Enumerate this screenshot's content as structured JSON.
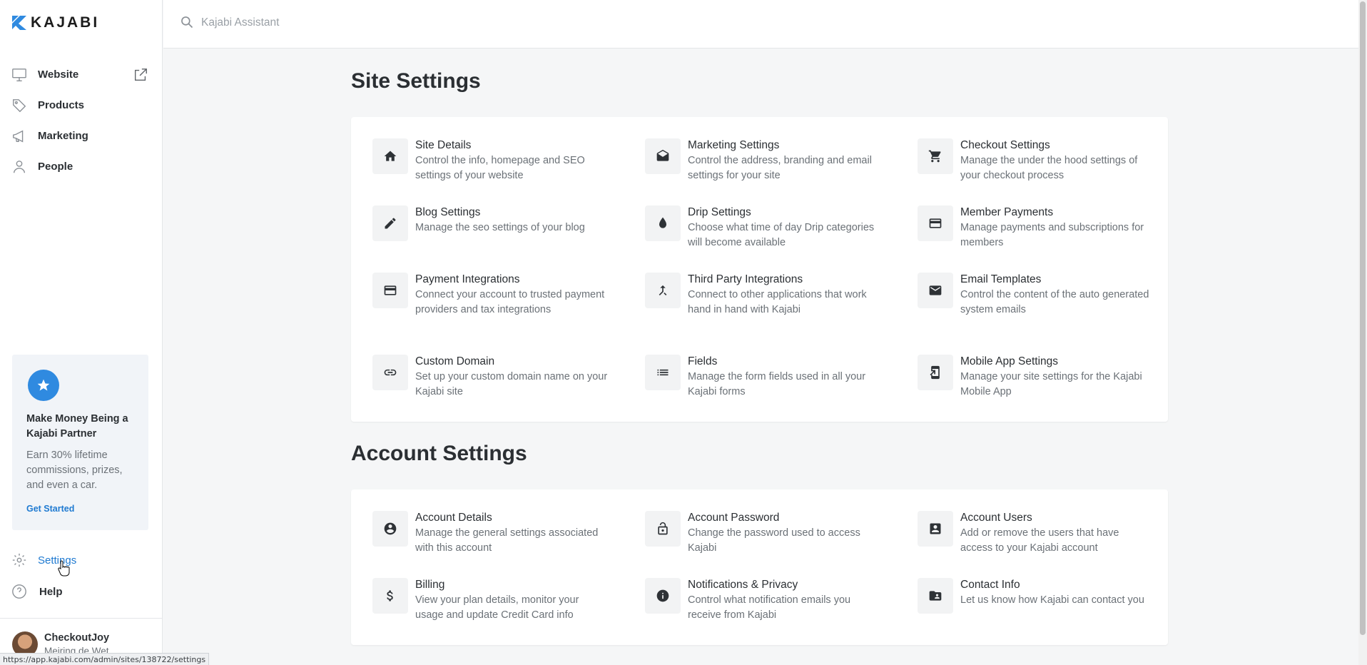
{
  "brand": {
    "name": "KAJABI",
    "color": "#2f8ae0"
  },
  "search": {
    "placeholder": "Kajabi Assistant",
    "value": ""
  },
  "sidebar": {
    "items": [
      {
        "label": "Website",
        "icon": "monitor-icon"
      },
      {
        "label": "Products",
        "icon": "tag-icon"
      },
      {
        "label": "Marketing",
        "icon": "megaphone-icon"
      },
      {
        "label": "People",
        "icon": "person-icon"
      }
    ],
    "promo": {
      "title": "Make Money Being a Kajabi Partner",
      "description": "Earn 30% lifetime commissions, prizes, and even a car.",
      "link": "Get Started"
    },
    "settings_label": "Settings",
    "help_label": "Help",
    "user": {
      "name": "CheckoutJoy",
      "subtitle": "Meiring de Wet"
    }
  },
  "status_url": "https://app.kajabi.com/admin/sites/138722/settings",
  "site_settings": {
    "title": "Site Settings",
    "tiles": [
      {
        "title": "Site Details",
        "desc": "Control the info, homepage and SEO settings of your website",
        "icon": "home-icon"
      },
      {
        "title": "Marketing Settings",
        "desc": "Control the address, branding and email settings for your site",
        "icon": "open-envelope-icon"
      },
      {
        "title": "Checkout Settings",
        "desc": "Manage the under the hood settings of your checkout process",
        "icon": "cart-icon"
      },
      {
        "title": "Blog Settings",
        "desc": "Manage the seo settings of your blog",
        "icon": "pencil-icon"
      },
      {
        "title": "Drip Settings",
        "desc": "Choose what time of day Drip categories will become available",
        "icon": "drop-icon"
      },
      {
        "title": "Member Payments",
        "desc": "Manage payments and subscriptions for members",
        "icon": "credit-card-icon"
      },
      {
        "title": "Payment Integrations",
        "desc": "Connect your account to trusted payment providers and tax integrations",
        "icon": "credit-card-icon"
      },
      {
        "title": "Third Party Integrations",
        "desc": "Connect to other applications that work hand in hand with Kajabi",
        "icon": "merge-arrows-icon"
      },
      {
        "title": "Email Templates",
        "desc": "Control the content of the auto generated system emails",
        "icon": "envelope-icon"
      },
      {
        "title": "Custom Domain",
        "desc": "Set up your custom domain name on your Kajabi site",
        "icon": "link-icon"
      },
      {
        "title": "Fields",
        "desc": "Manage the form fields used in all your Kajabi forms",
        "icon": "list-icon"
      },
      {
        "title": "Mobile App Settings",
        "desc": "Manage your site settings for the Kajabi Mobile App",
        "icon": "mobile-icon"
      }
    ]
  },
  "account_settings": {
    "title": "Account Settings",
    "tiles": [
      {
        "title": "Account Details",
        "desc": "Manage the general settings associated with this account",
        "icon": "account-circle-icon"
      },
      {
        "title": "Account Password",
        "desc": "Change the password used to access Kajabi",
        "icon": "lock-icon"
      },
      {
        "title": "Account Users",
        "desc": "Add or remove the users that have access to your Kajabi account",
        "icon": "contact-box-icon"
      },
      {
        "title": "Billing",
        "desc": "View your plan details, monitor your usage and update Credit Card info",
        "icon": "dollar-icon"
      },
      {
        "title": "Notifications & Privacy",
        "desc": "Control what notification emails you receive from Kajabi",
        "icon": "info-icon"
      },
      {
        "title": "Contact Info",
        "desc": "Let us know how Kajabi can contact you",
        "icon": "contact-card-icon"
      }
    ]
  }
}
